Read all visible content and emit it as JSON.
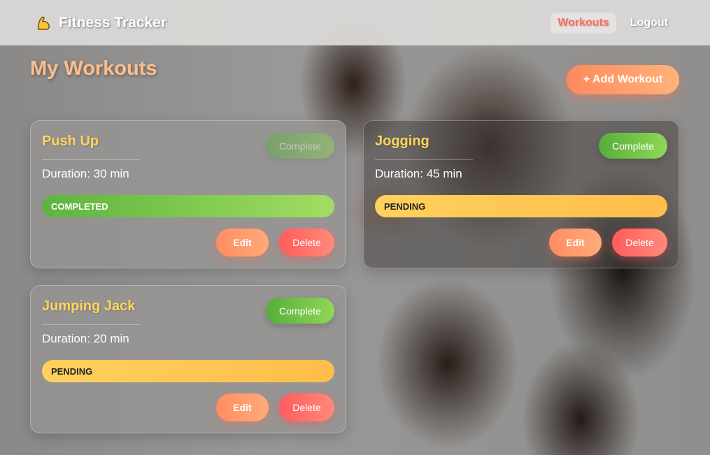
{
  "colors": {
    "title_peach": "#ffbe8a",
    "card_title_yellow": "#ffd45c",
    "active_nav_coral": "#ff6b57",
    "complete_green": "#57ad3b",
    "pending_yellow": "#ffd15e",
    "delete_red": "#ff5c5c"
  },
  "nav": {
    "brand_icon": "flexed-biceps-icon",
    "brand": "Fitness Tracker",
    "links": [
      {
        "label": "Workouts",
        "active": true
      },
      {
        "label": "Logout",
        "active": false
      }
    ]
  },
  "page": {
    "title": "My Workouts",
    "add_button": "+ Add Workout"
  },
  "workouts": [
    {
      "name": "Push Up",
      "duration": "Duration: 30 min",
      "status": "COMPLETED",
      "complete_label": "Complete",
      "complete_disabled": true,
      "edit_label": "Edit",
      "delete_label": "Delete"
    },
    {
      "name": "Jogging",
      "duration": "Duration: 45 min",
      "status": "PENDING",
      "complete_label": "Complete",
      "complete_disabled": false,
      "edit_label": "Edit",
      "delete_label": "Delete"
    },
    {
      "name": "Jumping Jack",
      "duration": "Duration: 20 min",
      "status": "PENDING",
      "complete_label": "Complete",
      "complete_disabled": false,
      "edit_label": "Edit",
      "delete_label": "Delete"
    }
  ]
}
